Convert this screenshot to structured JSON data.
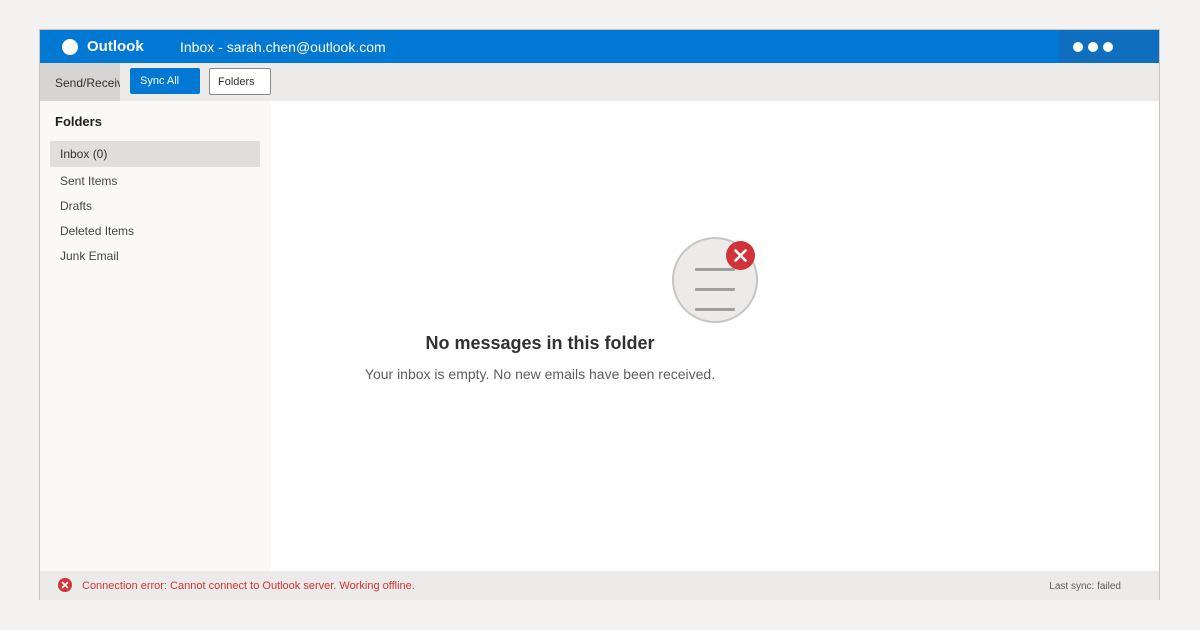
{
  "titlebar": {
    "app_name": "Outlook",
    "window_title": "Inbox - sarah.chen@outlook.com",
    "accent_color": "#0078d4"
  },
  "toolbar": {
    "tab_label": "Send/Receive",
    "sync_all_label": "Sync All",
    "folders_label": "Folders"
  },
  "sidebar": {
    "heading": "Folders",
    "items": [
      {
        "label": "Inbox (0)",
        "selected": true
      },
      {
        "label": "Sent Items"
      },
      {
        "label": "Drafts"
      },
      {
        "label": "Deleted Items"
      },
      {
        "label": "Junk Email"
      }
    ]
  },
  "main": {
    "empty_icon": "mail-empty-icon",
    "badge_icon": "error-x-icon",
    "empty_title": "No messages in this folder",
    "empty_subtitle": "Your inbox is empty. No new emails have been received."
  },
  "statusbar": {
    "error_icon": "error-x-icon",
    "error_text": "Connection error: Cannot connect to Outlook server. Working offline.",
    "sync_status": "Last sync: failed",
    "error_color": "#d13438"
  }
}
